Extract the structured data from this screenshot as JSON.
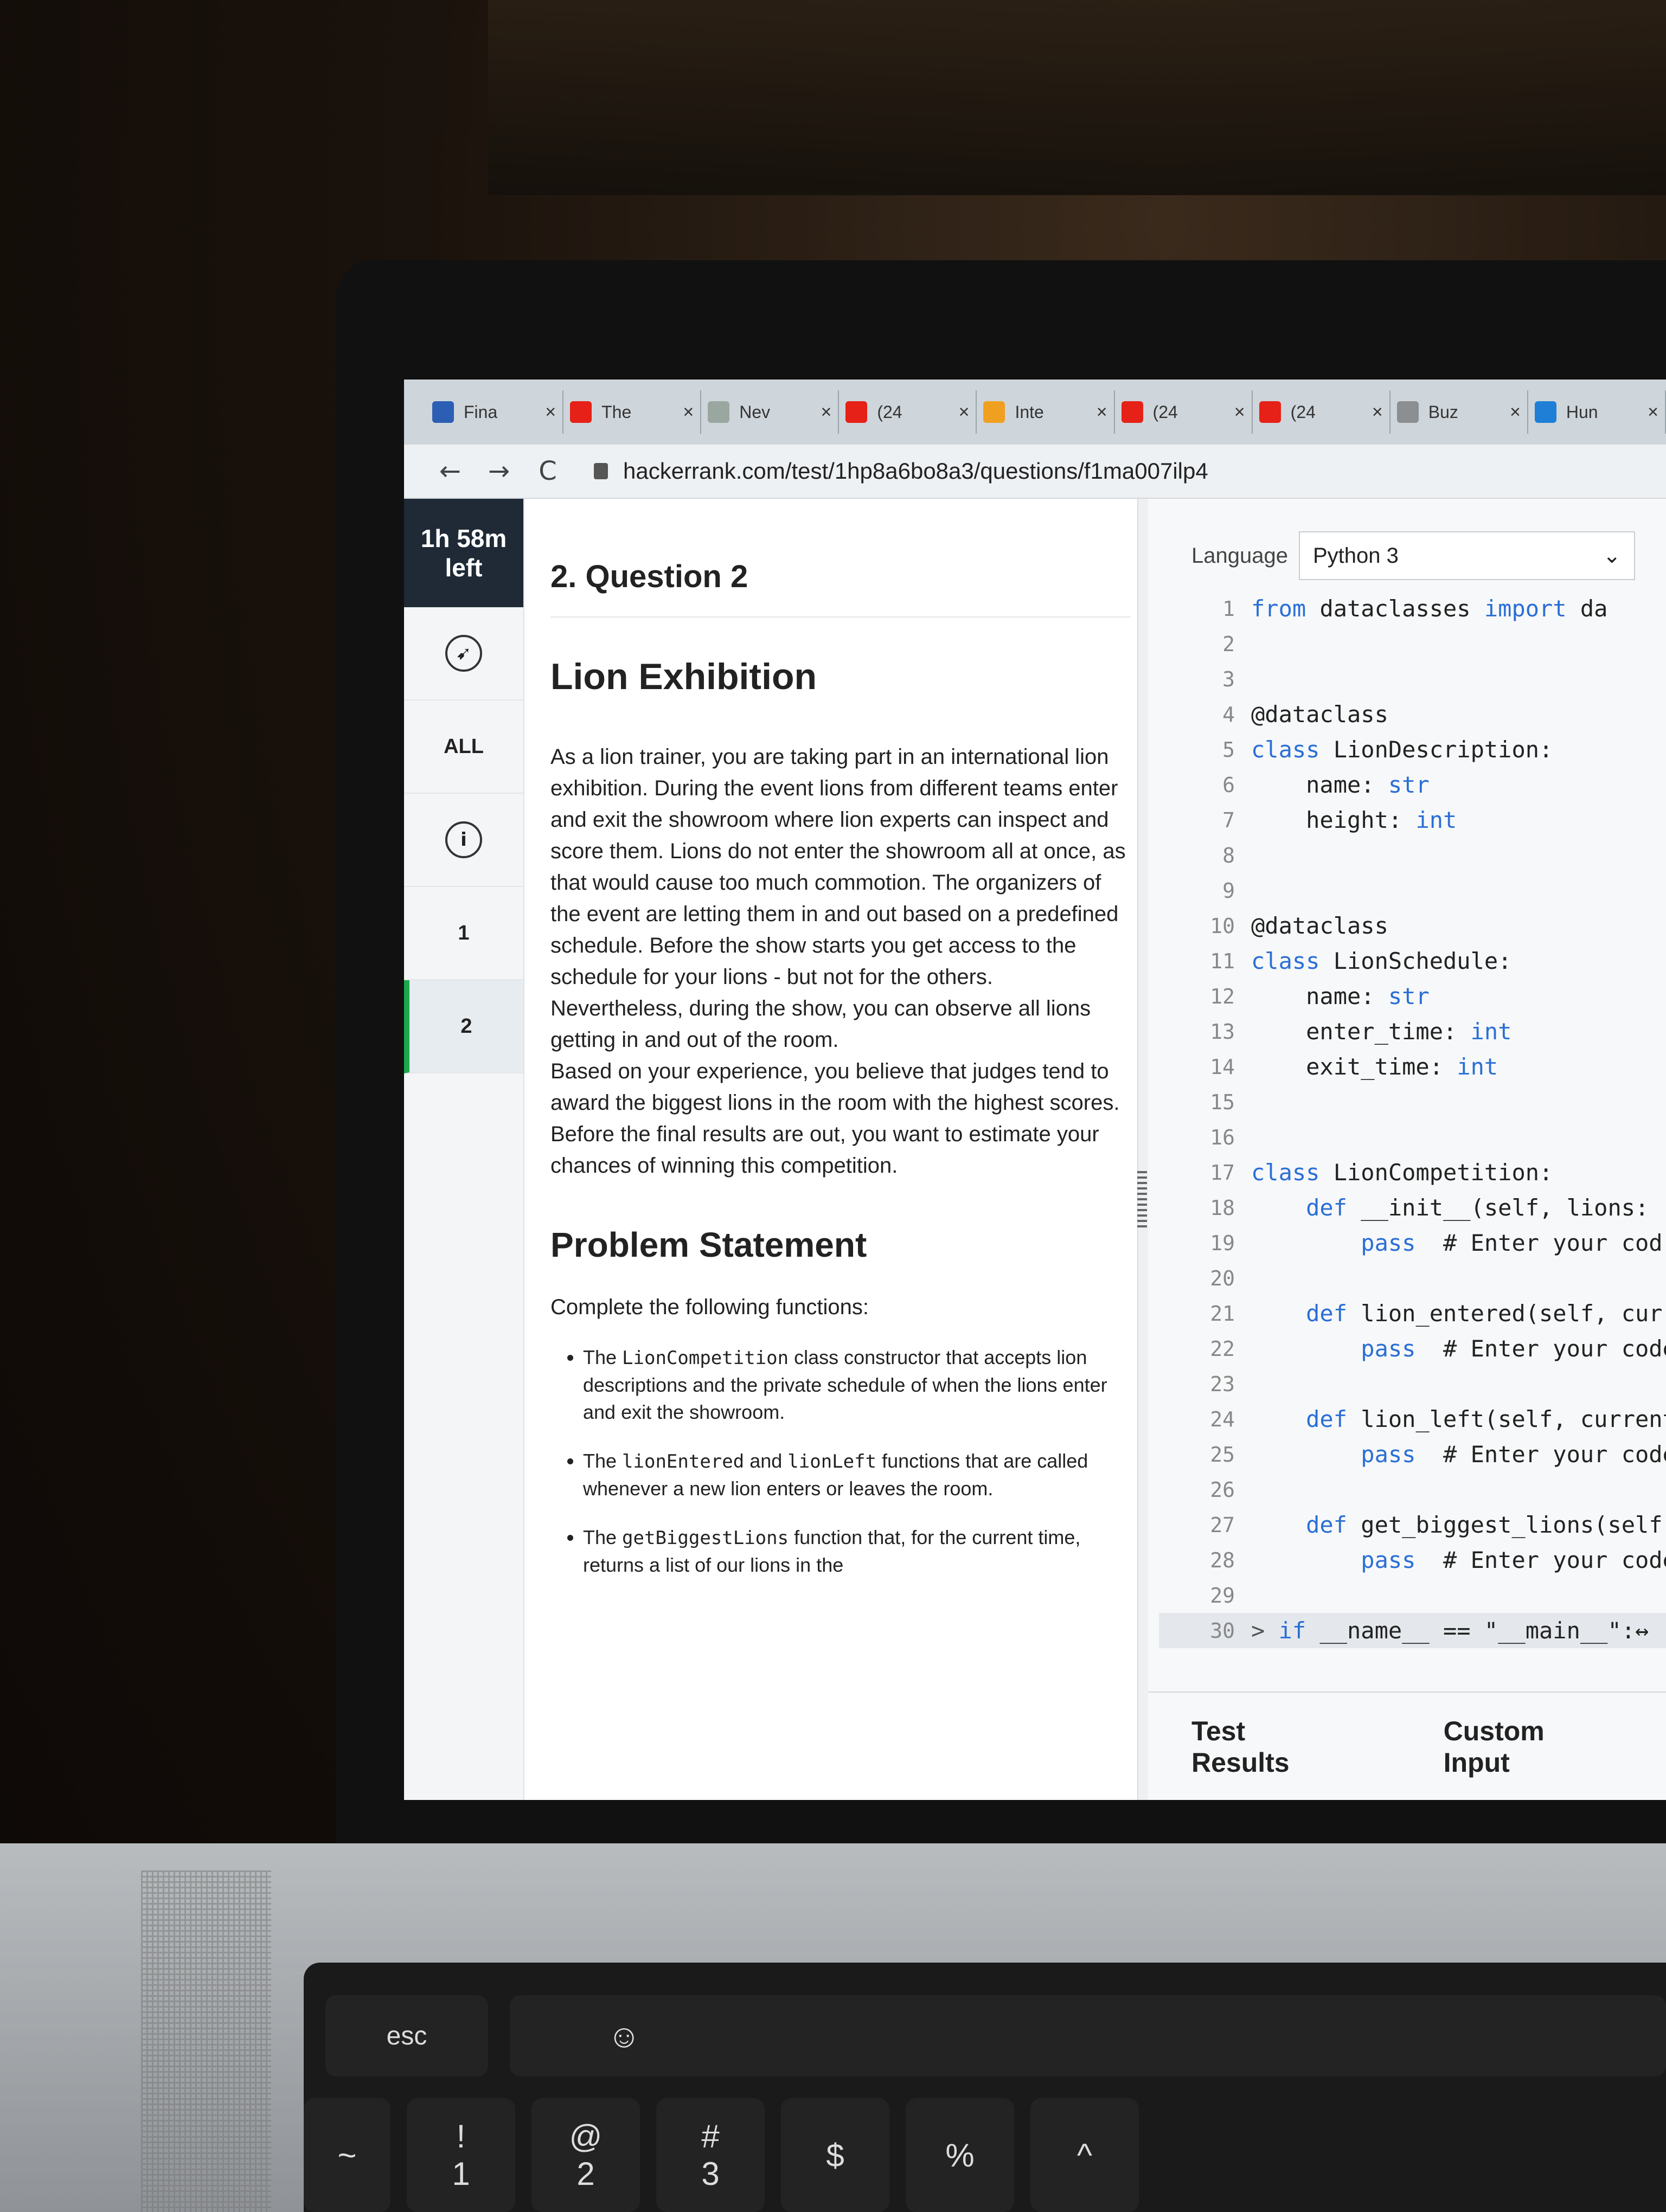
{
  "tabs": [
    {
      "label": "Fina",
      "icon": "trello-icon",
      "color": "#2c5fb3"
    },
    {
      "label": "The",
      "icon": "youtube-icon",
      "color": "#e62117"
    },
    {
      "label": "Nev",
      "icon": "openai-icon",
      "color": "#9aa6a0"
    },
    {
      "label": "(24",
      "icon": "youtube-icon",
      "color": "#e62117"
    },
    {
      "label": "Inte",
      "icon": "orange-circle-icon",
      "color": "#f0a020"
    },
    {
      "label": "(24",
      "icon": "youtube-icon",
      "color": "#e62117"
    },
    {
      "label": "(24",
      "icon": "youtube-icon",
      "color": "#e62117"
    },
    {
      "label": "Buz",
      "icon": "site-icon",
      "color": "#8b8f92"
    },
    {
      "label": "Hun",
      "icon": "site-icon",
      "color": "#1f7fd6"
    }
  ],
  "browser": {
    "back": "←",
    "forward": "→",
    "reload": "C",
    "url": "hackerrank.com/test/1hp8a6bo8a3/questions/f1ma007ilp4"
  },
  "sidebar": {
    "timer_line1": "1h 58m",
    "timer_line2": "left",
    "all_label": "ALL",
    "info_glyph": "i",
    "items": [
      "1",
      "2"
    ]
  },
  "question": {
    "number": "2. Question 2",
    "title": "Lion Exhibition",
    "intro": "As a lion trainer, you are taking part in an international lion exhibition. During the event lions from different teams enter and exit the showroom where lion experts can inspect and score them. Lions do not enter the showroom all at once, as that would cause too much commotion. The organizers of the event are letting them in and out based on a predefined schedule. Before the show starts you get access to the schedule for your lions - but not for the others. Nevertheless, during the show, you can observe all lions getting in and out of the room.",
    "intro2": "Based on your experience, you believe that judges tend to award the biggest lions in the room with the highest scores. Before the final results are out, you want to estimate your chances of winning this competition.",
    "problem_heading": "Problem Statement",
    "complete_text": "Complete the following functions:",
    "bullets": [
      {
        "pre": "The ",
        "code": "LionCompetition",
        "post": " class constructor that accepts lion descriptions and the private schedule of when the lions enter and exit the showroom."
      },
      {
        "pre": "The ",
        "code": "lionEntered",
        "mid": " and ",
        "code2": "lionLeft",
        "post": " functions that are called whenever a new lion enters or leaves the room."
      },
      {
        "pre": "The ",
        "code": "getBiggestLions",
        "post": " function that, for the current time, returns a list of our lions in the"
      }
    ]
  },
  "editor": {
    "language_label": "Language",
    "language_value": "Python 3",
    "lines": [
      {
        "n": "1",
        "t": [
          [
            "kw",
            "from"
          ],
          [
            "",
            " dataclasses "
          ],
          [
            "kw",
            "import"
          ],
          [
            "",
            " da"
          ]
        ]
      },
      {
        "n": "2",
        "t": []
      },
      {
        "n": "3",
        "t": []
      },
      {
        "n": "4",
        "t": [
          [
            "",
            "@dataclass"
          ]
        ]
      },
      {
        "n": "5",
        "t": [
          [
            "kw",
            "class"
          ],
          [
            "",
            " LionDescription:"
          ]
        ]
      },
      {
        "n": "6",
        "t": [
          [
            "",
            "    name: "
          ],
          [
            "kw",
            "str"
          ]
        ]
      },
      {
        "n": "7",
        "t": [
          [
            "",
            "    height: "
          ],
          [
            "kw",
            "int"
          ]
        ]
      },
      {
        "n": "8",
        "t": []
      },
      {
        "n": "9",
        "t": []
      },
      {
        "n": "10",
        "t": [
          [
            "",
            "@dataclass"
          ]
        ]
      },
      {
        "n": "11",
        "t": [
          [
            "kw",
            "class"
          ],
          [
            "",
            " LionSchedule:"
          ]
        ]
      },
      {
        "n": "12",
        "t": [
          [
            "",
            "    name: "
          ],
          [
            "kw",
            "str"
          ]
        ]
      },
      {
        "n": "13",
        "t": [
          [
            "",
            "    enter_time: "
          ],
          [
            "kw",
            "int"
          ]
        ]
      },
      {
        "n": "14",
        "t": [
          [
            "",
            "    exit_time: "
          ],
          [
            "kw",
            "int"
          ]
        ]
      },
      {
        "n": "15",
        "t": []
      },
      {
        "n": "16",
        "t": []
      },
      {
        "n": "17",
        "t": [
          [
            "kw",
            "class"
          ],
          [
            "",
            " LionCompetition:"
          ]
        ]
      },
      {
        "n": "18",
        "t": [
          [
            "kw",
            "    def"
          ],
          [
            "",
            " __init__(self, lions:"
          ]
        ]
      },
      {
        "n": "19",
        "t": [
          [
            "kw",
            "        pass"
          ],
          [
            "",
            "  # Enter your cod"
          ]
        ]
      },
      {
        "n": "20",
        "t": []
      },
      {
        "n": "21",
        "t": [
          [
            "kw",
            "    def"
          ],
          [
            "",
            " lion_entered(self, curr"
          ]
        ]
      },
      {
        "n": "22",
        "t": [
          [
            "kw",
            "        pass"
          ],
          [
            "",
            "  # Enter your code"
          ]
        ]
      },
      {
        "n": "23",
        "t": []
      },
      {
        "n": "24",
        "t": [
          [
            "kw",
            "    def"
          ],
          [
            "",
            " lion_left(self, current_"
          ]
        ]
      },
      {
        "n": "25",
        "t": [
          [
            "kw",
            "        pass"
          ],
          [
            "",
            "  # Enter your code"
          ]
        ]
      },
      {
        "n": "26",
        "t": []
      },
      {
        "n": "27",
        "t": [
          [
            "kw",
            "    def"
          ],
          [
            "",
            " get_biggest_lions(self)"
          ]
        ]
      },
      {
        "n": "28",
        "t": [
          [
            "kw",
            "        pass"
          ],
          [
            "",
            "  # Enter your code"
          ]
        ]
      },
      {
        "n": "29",
        "t": []
      },
      {
        "n": "30",
        "t": [
          [
            "fold",
            "> "
          ],
          [
            "kw",
            "if"
          ],
          [
            "",
            " __name__ == \"__main__\":↔"
          ]
        ]
      }
    ],
    "results_tab": "Test Results",
    "custom_tab": "Custom Input"
  },
  "keyboard": {
    "esc": "esc",
    "emoji": "☺",
    "keys": [
      "~",
      "!",
      "1",
      "@",
      "2",
      "#",
      "3",
      "$",
      "%",
      "^"
    ]
  }
}
